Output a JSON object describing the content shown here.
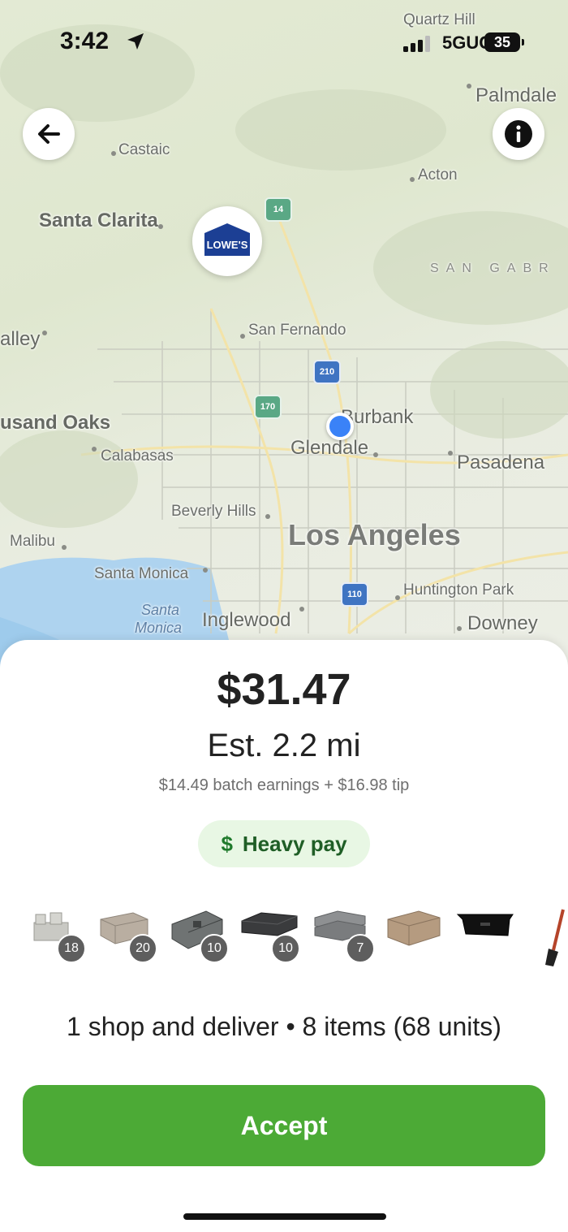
{
  "status_bar": {
    "time": "3:42",
    "network": "5GUC",
    "battery": "35"
  },
  "map": {
    "places": [
      "Quartz Hill",
      "Palmdale",
      "Castaic",
      "Acton",
      "Santa Clarita",
      "SAN GABR",
      "alley",
      "San Fernando",
      "usand Oaks",
      "Burbank",
      "Glendale",
      "Calabasas",
      "Pasadena",
      "Beverly Hills",
      "Los Angeles",
      "Malibu",
      "Santa Monica",
      "Huntington Park",
      "Santa",
      "Monica",
      "Inglewood",
      "Downey"
    ],
    "highways": [
      "14",
      "210",
      "170",
      "110"
    ],
    "store_logo": "LOWE'S"
  },
  "offer": {
    "price": "$31.47",
    "distance": "Est. 2.2 mi",
    "breakdown": "$14.49 batch earnings + $16.98 tip",
    "badge": {
      "icon": "dollar-icon",
      "label": "Heavy pay"
    },
    "item_counts": [
      "18",
      "20",
      "10",
      "10",
      "7"
    ],
    "summary": "1 shop and deliver • 8 items (68 units)",
    "accept_label": "Accept"
  },
  "colors": {
    "accept": "#4caa36",
    "badge_bg": "#e8f7e4",
    "badge_text": "#1f5e26",
    "user_dot": "#3a82f7",
    "lowes": "#1c3f94"
  }
}
